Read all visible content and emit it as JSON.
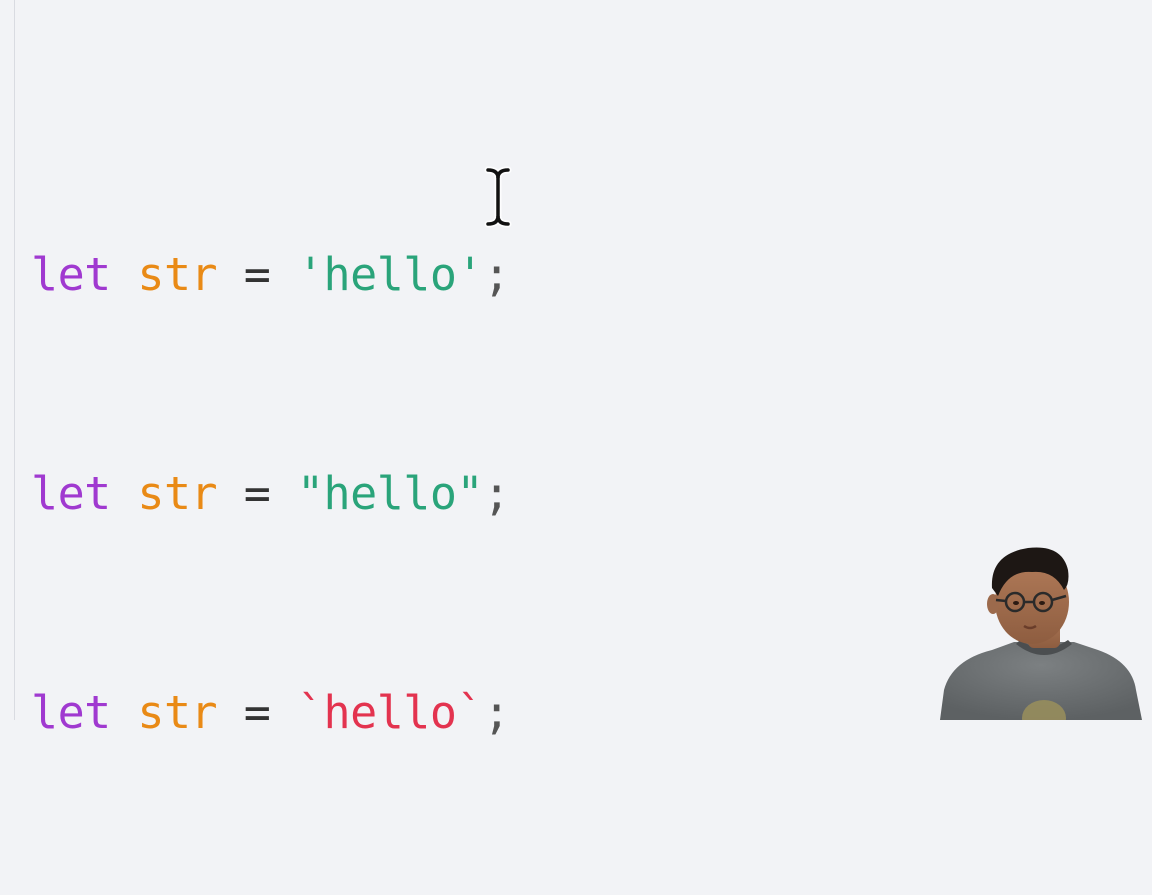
{
  "editor": {
    "lines": [
      {
        "keyword": "let",
        "identifier": "str",
        "operator": "=",
        "string": "'hello'",
        "terminator": ";",
        "string_kind": "single-quote"
      },
      {
        "keyword": "let",
        "identifier": "str",
        "operator": "=",
        "string": "\"hello\"",
        "terminator": ";",
        "string_kind": "double-quote"
      },
      {
        "keyword": "let",
        "identifier": "str",
        "operator": "=",
        "string": "`hello`",
        "terminator": ";",
        "string_kind": "backtick"
      }
    ],
    "colors": {
      "background": "#f2f3f6",
      "keyword": "#a039d0",
      "identifier": "#e98a16",
      "string": "#2aa47a",
      "template_string": "#e3334f"
    }
  },
  "cursor": {
    "type": "text-ibeam-cursor"
  },
  "overlay": {
    "type": "presenter-webcam"
  }
}
